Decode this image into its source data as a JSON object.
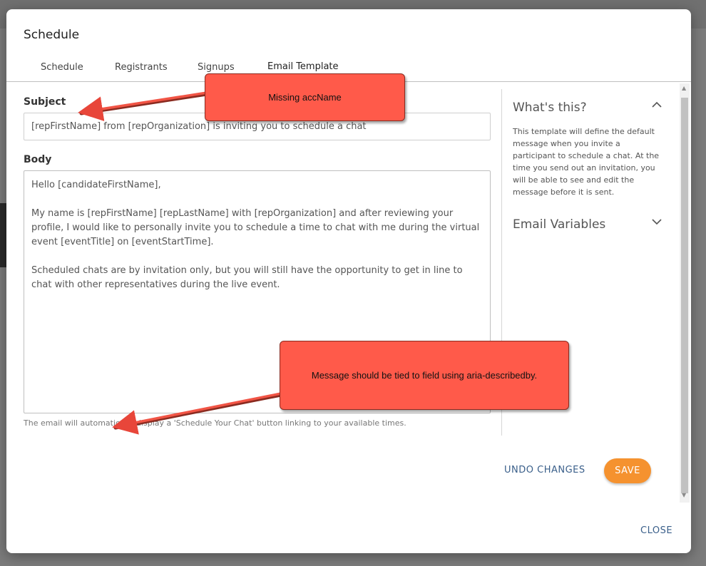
{
  "modal": {
    "title": "Schedule",
    "tabs": [
      {
        "label": "Schedule"
      },
      {
        "label": "Registrants"
      },
      {
        "label": "Signups"
      },
      {
        "label": "Email Template"
      }
    ]
  },
  "form": {
    "subject_label": "Subject",
    "subject_value": "[repFirstName] from [repOrganization] is inviting you to schedule a chat",
    "body_label": "Body",
    "body_lines": {
      "greeting": "Hello [candidateFirstName],",
      "p1": "My name is [repFirstName] [repLastName] with [repOrganization] and after reviewing your profile, I would like to personally invite you to schedule a time to chat with me during the virtual event [eventTitle] on [eventStartTime].",
      "p2": "Scheduled chats are by invitation only, but you will still have the opportunity to get in line to chat with other representatives during the live event."
    },
    "helper_text": "The email will automatically display a 'Schedule Your Chat' button linking to your available times."
  },
  "side_panel": {
    "whats_this_heading": "What's this?",
    "whats_this_text": "This template will define the default message when you invite a participant to schedule a chat. At the time you send out an invitation, you will be able to see and edit the message before it is sent.",
    "email_variables_heading": "Email Variables"
  },
  "actions": {
    "undo_label": "UNDO CHANGES",
    "save_label": "SAVE",
    "close_label": "CLOSE"
  },
  "annotations": {
    "callout_1": "Missing accName",
    "callout_2": "Message should be tied to field using aria-describedby."
  },
  "colors": {
    "save_button": "#f5922f",
    "link_buttons": "#3a5f8a",
    "callout_fill": "#ff5a4a"
  }
}
